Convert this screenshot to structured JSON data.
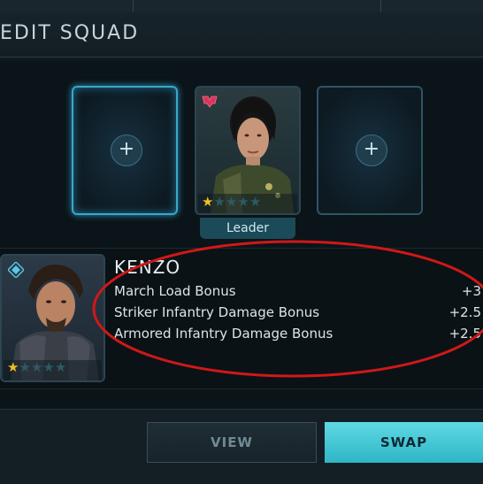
{
  "header": {
    "title": "EDIT SQUAD"
  },
  "squad": {
    "slots": [
      {
        "state": "empty",
        "icon": "plus-icon",
        "plus": "+"
      },
      {
        "state": "filled",
        "icon": "commander-badge-icon",
        "stars": "★★★★★",
        "stars_filled": 1,
        "stars_total": 5
      },
      {
        "state": "empty",
        "icon": "plus-icon",
        "plus": "+"
      }
    ],
    "leader_label": "Leader"
  },
  "selected_hero": {
    "name": "KENZO",
    "badge_icon": "diamond-emblem-icon",
    "stars": "★★★★★",
    "stars_filled": 1,
    "stars_total": 5,
    "stats": [
      {
        "label": "March Load Bonus",
        "value": "+3"
      },
      {
        "label": "Striker Infantry Damage Bonus",
        "value": "+2.5"
      },
      {
        "label": "Armored Infantry Damage Bonus",
        "value": "+2.5"
      }
    ]
  },
  "actions": {
    "view_label": "VIEW",
    "swap_label": "SWAP"
  },
  "colors": {
    "accent": "#3fc6d6",
    "highlight_ring": "#d01818",
    "star_on": "#f0c020",
    "star_off": "#2c5a66"
  }
}
